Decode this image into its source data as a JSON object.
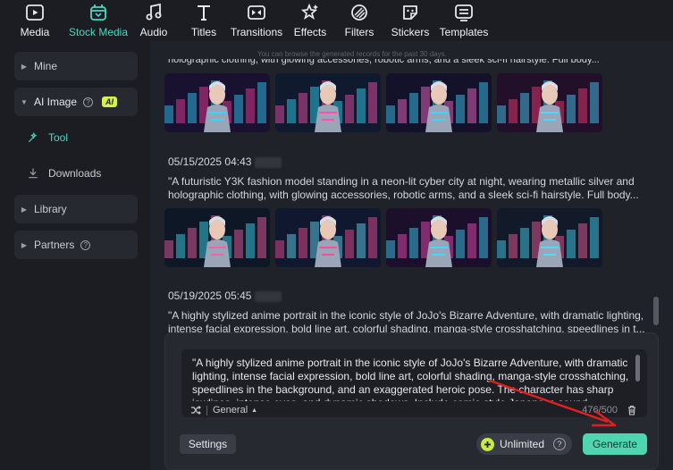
{
  "toolbar": {
    "items": [
      {
        "id": "media",
        "label": "Media",
        "icon": "media-icon",
        "active": false
      },
      {
        "id": "stock-media",
        "label": "Stock Media",
        "icon": "stock-media-icon",
        "active": true
      },
      {
        "id": "audio",
        "label": "Audio",
        "icon": "music-note-icon",
        "active": false
      },
      {
        "id": "titles",
        "label": "Titles",
        "icon": "titles-t-icon",
        "active": false
      },
      {
        "id": "transitions",
        "label": "Transitions",
        "icon": "transitions-icon",
        "active": false
      },
      {
        "id": "effects",
        "label": "Effects",
        "icon": "effects-star-icon",
        "active": false
      },
      {
        "id": "filters",
        "label": "Filters",
        "icon": "filters-icon",
        "active": false
      },
      {
        "id": "stickers",
        "label": "Stickers",
        "icon": "stickers-icon",
        "active": false
      },
      {
        "id": "templates",
        "label": "Templates",
        "icon": "templates-icon",
        "active": false
      }
    ]
  },
  "sidebar": {
    "mine": "Mine",
    "ai_image": "AI Image",
    "ai_badge": "AI",
    "tool": "Tool",
    "downloads": "Downloads",
    "library": "Library",
    "partners": "Partners"
  },
  "history": {
    "notice": "You can browse the generated records for the past 30 days.",
    "cut_prompt": "holographic clothing, with glowing accessories, robotic arms, and a sleek sci-fi hairstyle. Full body...",
    "records": [
      {
        "date": "05/15/2025 04:43",
        "prompt": "\"A futuristic Y3K fashion model standing in a neon-lit cyber city at night, wearing metallic silver and holographic clothing, with glowing accessories, robotic arms, and a sleek sci-fi hairstyle. Full body..."
      },
      {
        "date": "05/19/2025 05:45",
        "prompt": "\"A highly stylized anime portrait in the iconic style of JoJo's Bizarre Adventure, with dramatic lighting, intense facial expression, bold line art, colorful shading, manga-style crosshatching, speedlines in t..."
      }
    ]
  },
  "prompt_panel": {
    "text": "\"A highly stylized anime portrait in the iconic style of JoJo's Bizarre Adventure, with dramatic lighting, intense facial expression, bold line art, colorful shading, manga-style crosshatching, speedlines in the background, and an exaggerated heroic pose. The character has sharp jawlines, intense eyes, and dynamic shadows. Include comic-style Japanese sound",
    "style": "General",
    "counter": "476/500",
    "settings_label": "Settings",
    "unlimited_label": "Unlimited",
    "generate_label": "Generate"
  },
  "colors": {
    "accent": "#4fd6c1",
    "generate": "#4fd6b0",
    "ai_badge": "#d8f04a",
    "arrow": "#e0201e"
  }
}
